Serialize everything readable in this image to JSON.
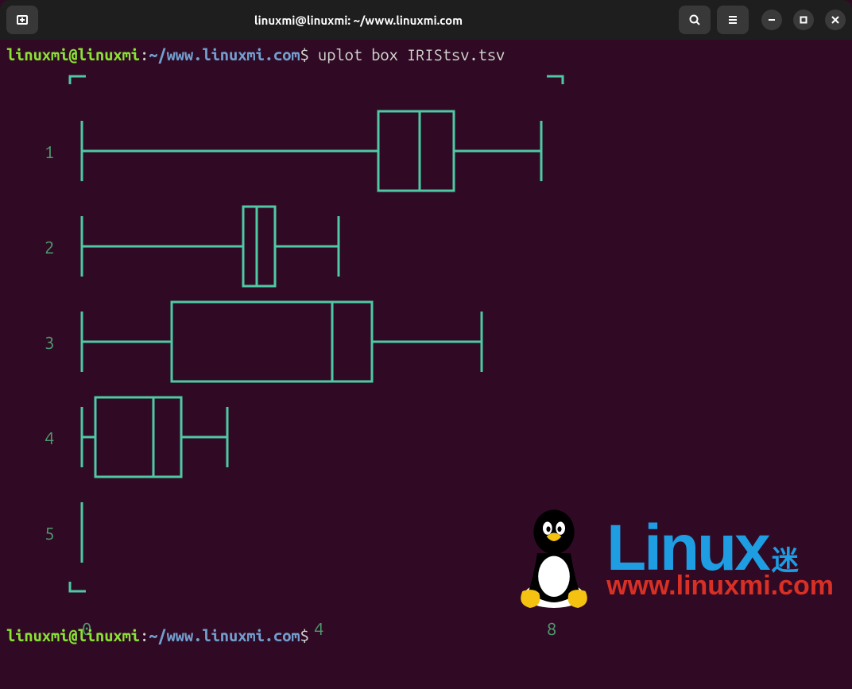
{
  "titlebar": {
    "title": "linuxmi@linuxmi: ~/www.linuxmi.com"
  },
  "prompt1": {
    "user": "linuxmi@linuxmi",
    "path": "~/www.linuxmi.com",
    "command": "uplot box IRIStsv.tsv"
  },
  "prompt2": {
    "user": "linuxmi@linuxmi",
    "path": "~/www.linuxmi.com",
    "command": ""
  },
  "x_ticks": {
    "t0": "0",
    "t4": "4",
    "t8": "8"
  },
  "y_labels": {
    "y1": "1",
    "y2": "2",
    "y3": "3",
    "y4": "4",
    "y5": "5"
  },
  "watermark": {
    "brand": "Linux",
    "suffix": "迷",
    "url": "www.linuxmi.com"
  },
  "chart_data": {
    "type": "box",
    "xlim": [
      0,
      9.6
    ],
    "categories": [
      "1",
      "2",
      "3",
      "4",
      "5"
    ],
    "series": [
      {
        "name": "1",
        "min": 0.1,
        "q1": 5.1,
        "median": 5.8,
        "q3": 6.4,
        "max": 7.9
      },
      {
        "name": "2",
        "min": 0.1,
        "q1": 2.8,
        "median": 3.0,
        "q3": 3.3,
        "max": 4.4
      },
      {
        "name": "3",
        "min": 0.1,
        "q1": 1.6,
        "median": 4.3,
        "q3": 5.1,
        "max": 6.9
      },
      {
        "name": "4",
        "min": 0.1,
        "q1": 0.3,
        "median": 1.3,
        "q3": 1.8,
        "max": 2.5
      },
      {
        "name": "5",
        "min": 0.1,
        "q1": 0.1,
        "median": 0.1,
        "q3": 0.1,
        "max": 0.1
      }
    ],
    "xlabel": "",
    "ylabel": "",
    "x_ticks": [
      0,
      4,
      8
    ]
  }
}
